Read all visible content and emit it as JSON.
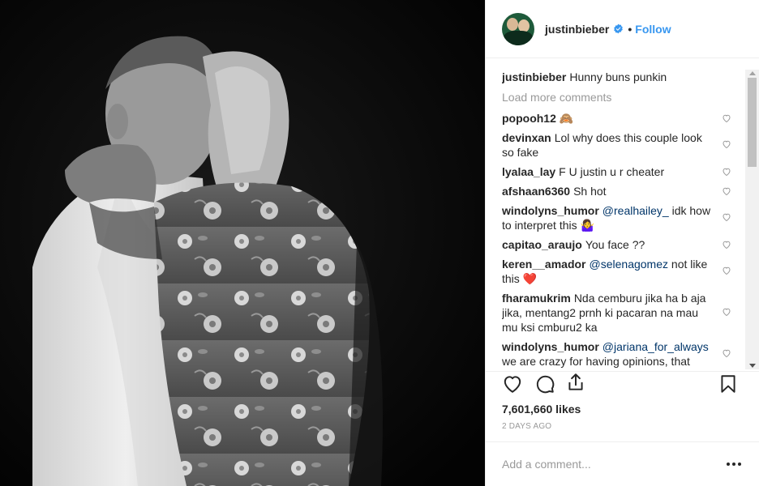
{
  "header": {
    "username": "justinbieber",
    "separator": "•",
    "follow_label": "Follow"
  },
  "caption": {
    "username": "justinbieber",
    "text": "Hunny buns punkin"
  },
  "load_more_label": "Load more comments",
  "comments": [
    {
      "username": "popooh12",
      "text": "🙈",
      "mention": ""
    },
    {
      "username": "devinxan",
      "text": "Lol why does this couple look so fake",
      "mention": ""
    },
    {
      "username": "lyalaa_lay",
      "text": "F U justin u r cheater",
      "mention": ""
    },
    {
      "username": "afshaan6360",
      "text": "Sh hot",
      "mention": ""
    },
    {
      "username": "windolyns_humor",
      "mention": "@realhailey_",
      "text": " idk how to interpret this 🤷‍♀️"
    },
    {
      "username": "capitao_araujo",
      "text": "You face ??",
      "mention": ""
    },
    {
      "username": "keren__amador",
      "mention": "@selenagomez",
      "text": " not like this ❤️"
    },
    {
      "username": "fharamukrim",
      "text": "Nda cemburu jika ha b aja jika, mentang2 prnh ki pacaran na mau mu ksi cmburu2 ka",
      "mention": ""
    },
    {
      "username": "windolyns_humor",
      "mention": "@jariana_for_always",
      "text": " we are crazy for having opinions, that"
    }
  ],
  "likes_text": "7,601,660 likes",
  "time_text": "2 DAYS AGO",
  "add_comment_placeholder": "Add a comment...",
  "colors": {
    "accent": "#3897f0",
    "text": "#262626",
    "muted": "#999999",
    "mention": "#003569"
  },
  "icons": {
    "verified": "verified-badge-icon",
    "like": "heart-icon",
    "comment": "comment-bubble-icon",
    "share": "share-icon",
    "save": "bookmark-icon",
    "more": "more-options-icon"
  }
}
